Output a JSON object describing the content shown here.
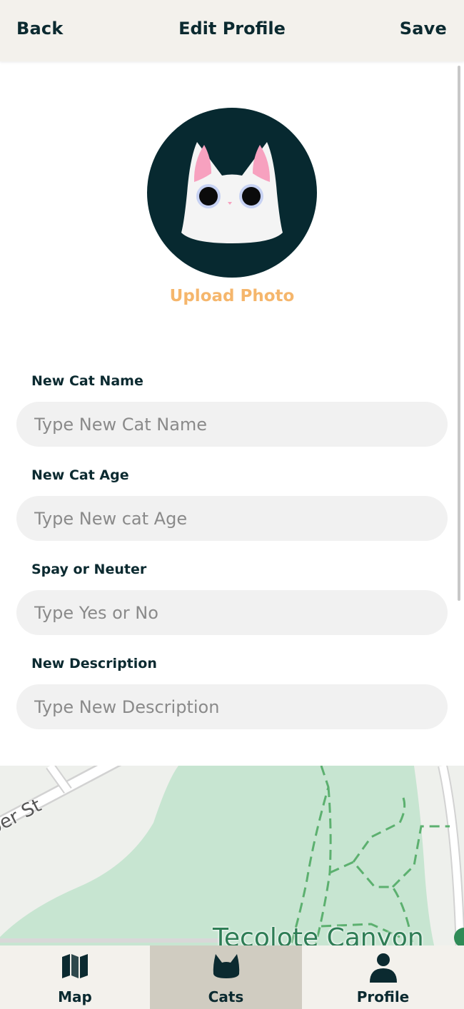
{
  "header": {
    "back_label": "Back",
    "title": "Edit Profile",
    "save_label": "Save"
  },
  "avatar": {
    "icon": "cat-face-icon",
    "upload_label": "Upload Photo"
  },
  "form": {
    "name": {
      "label": "New Cat Name",
      "placeholder": "Type New Cat Name",
      "value": ""
    },
    "age": {
      "label": "New Cat Age",
      "placeholder": "Type New cat Age",
      "value": ""
    },
    "spay": {
      "label": "Spay or Neuter",
      "placeholder": "Type Yes or No",
      "value": ""
    },
    "description": {
      "label": "New Description",
      "placeholder": "Type New Description",
      "value": ""
    }
  },
  "map": {
    "street_label": "ber St",
    "park_label": "Tecolote Canyon"
  },
  "nav": {
    "items": [
      {
        "label": "Map",
        "icon": "map-icon",
        "active": false
      },
      {
        "label": "Cats",
        "icon": "cat-ears-icon",
        "active": true
      },
      {
        "label": "Profile",
        "icon": "person-icon",
        "active": false
      }
    ]
  },
  "colors": {
    "header_bg": "#f3f1ec",
    "accent": "#f5b66c",
    "dark": "#072930",
    "active_tab": "#d0ccc1"
  }
}
